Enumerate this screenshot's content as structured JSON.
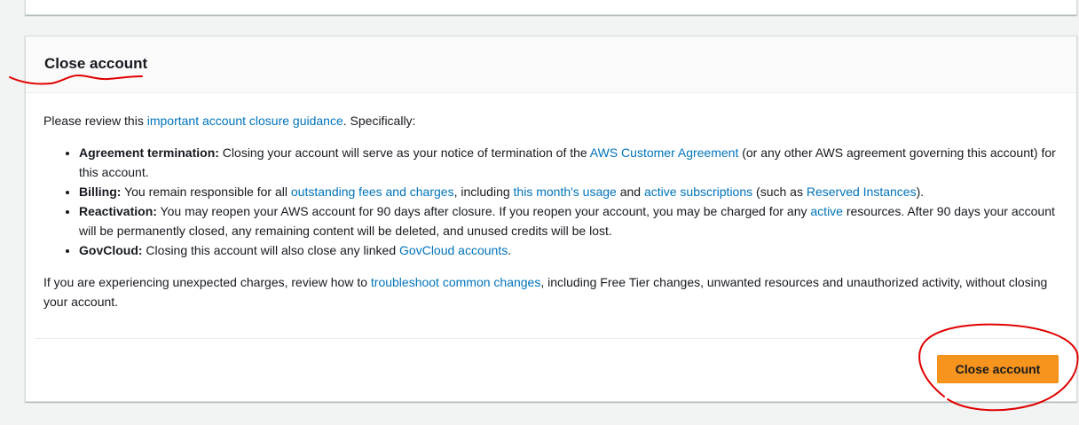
{
  "panel": {
    "title": "Close account",
    "intro": {
      "prefix": "Please review this ",
      "link": "important account closure guidance",
      "suffix": ". Specifically:"
    },
    "items": [
      {
        "label": "Agreement termination:",
        "t1": " Closing your account will serve as your notice of termination of the ",
        "l1": "AWS Customer Agreement",
        "t2": " (or any other AWS agreement governing this account) for this account."
      },
      {
        "label": "Billing:",
        "t1": " You remain responsible for all ",
        "l1": "outstanding fees and charges",
        "t2": ", including ",
        "l2": "this month's usage",
        "t3": " and ",
        "l3": "active subscriptions",
        "t4": " (such as ",
        "l4": "Reserved Instances",
        "t5": ")."
      },
      {
        "label": "Reactivation:",
        "t1": " You may reopen your AWS account for 90 days after closure. If you reopen your account, you may be charged for any ",
        "l1": "active",
        "t2": " resources. After 90 days your account will be permanently closed, any remaining content will be deleted, and unused credits will be lost."
      },
      {
        "label": "GovCloud:",
        "t1": " Closing this account will also close any linked ",
        "l1": "GovCloud accounts",
        "t2": "."
      }
    ],
    "outro": {
      "prefix": "If you are experiencing unexpected charges, review how to ",
      "link": "troubleshoot common changes",
      "suffix": ", including Free Tier changes, unwanted resources and unauthorized activity, without closing your account."
    },
    "button_label": "Close account"
  },
  "colors": {
    "link": "#0073bb",
    "button": "#f7941d",
    "annotation": "#e00000"
  }
}
